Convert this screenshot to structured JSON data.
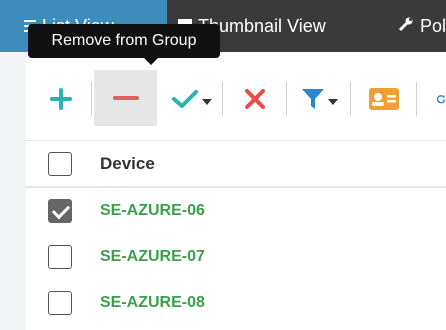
{
  "tabs": [
    {
      "label": "List View",
      "active": true
    },
    {
      "label": "Thumbnail View",
      "active": false
    },
    {
      "label": "Poli",
      "active": false
    }
  ],
  "tooltip": {
    "text": "Remove from Group"
  },
  "toolbar": {
    "buttons": [
      "add-icon",
      "remove-icon",
      "approve-icon",
      "delete-icon",
      "filter-icon",
      "contact-card-icon",
      "refresh-icon"
    ]
  },
  "table": {
    "header": "Device",
    "rows": [
      {
        "name": "SE-AZURE-06",
        "checked": true
      },
      {
        "name": "SE-AZURE-07",
        "checked": false
      },
      {
        "name": "SE-AZURE-08",
        "checked": false
      }
    ]
  },
  "colors": {
    "accent": "#3c8dbc",
    "device_link": "#3aa04a",
    "add": "#2bb3b0",
    "remove": "#e06060",
    "delete": "#e84c4c",
    "filter": "#2a88c8",
    "card": "#f0a030"
  }
}
